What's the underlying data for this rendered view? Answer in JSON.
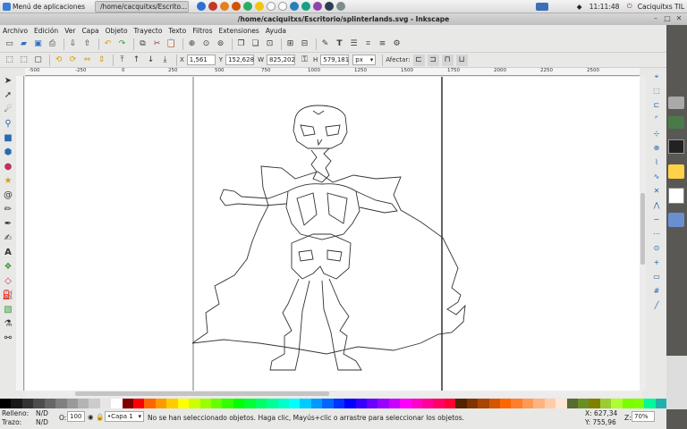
{
  "taskbar": {
    "menu_label": "Menú de aplicaciones",
    "window_button": "/home/cacquitxs/Escrito...",
    "clock": "11:11:48",
    "user": "Caciquitxs TIL"
  },
  "window": {
    "title": "/home/caciquitxs/Escritorio/splinterlands.svg - Inkscape"
  },
  "menu": [
    "Archivo",
    "Edición",
    "Ver",
    "Capa",
    "Objeto",
    "Trayecto",
    "Texto",
    "Filtros",
    "Extensiones",
    "Ayuda"
  ],
  "controls": {
    "x_label": "X",
    "x_value": "1,561",
    "y_label": "Y",
    "y_value": "152,628",
    "w_label": "W",
    "w_value": "825,202",
    "h_label": "H",
    "h_value": "579,181",
    "unit": "px",
    "affect_label": "Afectar:"
  },
  "ruler_marks": [
    "-500",
    "-250",
    "0",
    "250",
    "500",
    "750",
    "1000",
    "1250",
    "1500",
    "1750",
    "2000",
    "2250",
    "2500"
  ],
  "status": {
    "fill_label": "Relleno:",
    "fill_value": "N/D",
    "stroke_label": "Trazo:",
    "stroke_value": "N/D",
    "opacity_label": "O:",
    "opacity_value": "100",
    "layer": "•Capa 1",
    "message": "No se han seleccionado objetos. Haga clic, Mayús+clic o arrastre para seleccionar los objetos.",
    "x_coord": "X: 627,34",
    "y_coord": "Y: 755,96",
    "zoom_label": "Z:",
    "zoom": "70%"
  },
  "colors": {
    "palette": [
      "#000000",
      "#1a1a1a",
      "#333333",
      "#4d4d4d",
      "#666666",
      "#808080",
      "#999999",
      "#b3b3b3",
      "#cccccc",
      "#e6e6e6",
      "#ffffff",
      "#800000",
      "#ff0000",
      "#ff6600",
      "#ff9900",
      "#ffcc00",
      "#ffff00",
      "#ccff00",
      "#99ff00",
      "#66ff00",
      "#33ff00",
      "#00ff00",
      "#00ff33",
      "#00ff66",
      "#00ff99",
      "#00ffcc",
      "#00ffff",
      "#00ccff",
      "#0099ff",
      "#0066ff",
      "#0033ff",
      "#0000ff",
      "#3300ff",
      "#6600ff",
      "#9900ff",
      "#cc00ff",
      "#ff00ff",
      "#ff00cc",
      "#ff0099",
      "#ff0066",
      "#ff0033",
      "#552200",
      "#803300",
      "#aa4400",
      "#d45500",
      "#ff6600",
      "#ff7f2a",
      "#ff9955",
      "#ffb380",
      "#ffccaa",
      "#ffe6d5",
      "#556b2f",
      "#6b8e23",
      "#808000",
      "#9acd32",
      "#adff2f",
      "#7cfc00",
      "#7fff00",
      "#00fa9a",
      "#20b2aa"
    ],
    "accent": "#1a62b0"
  }
}
